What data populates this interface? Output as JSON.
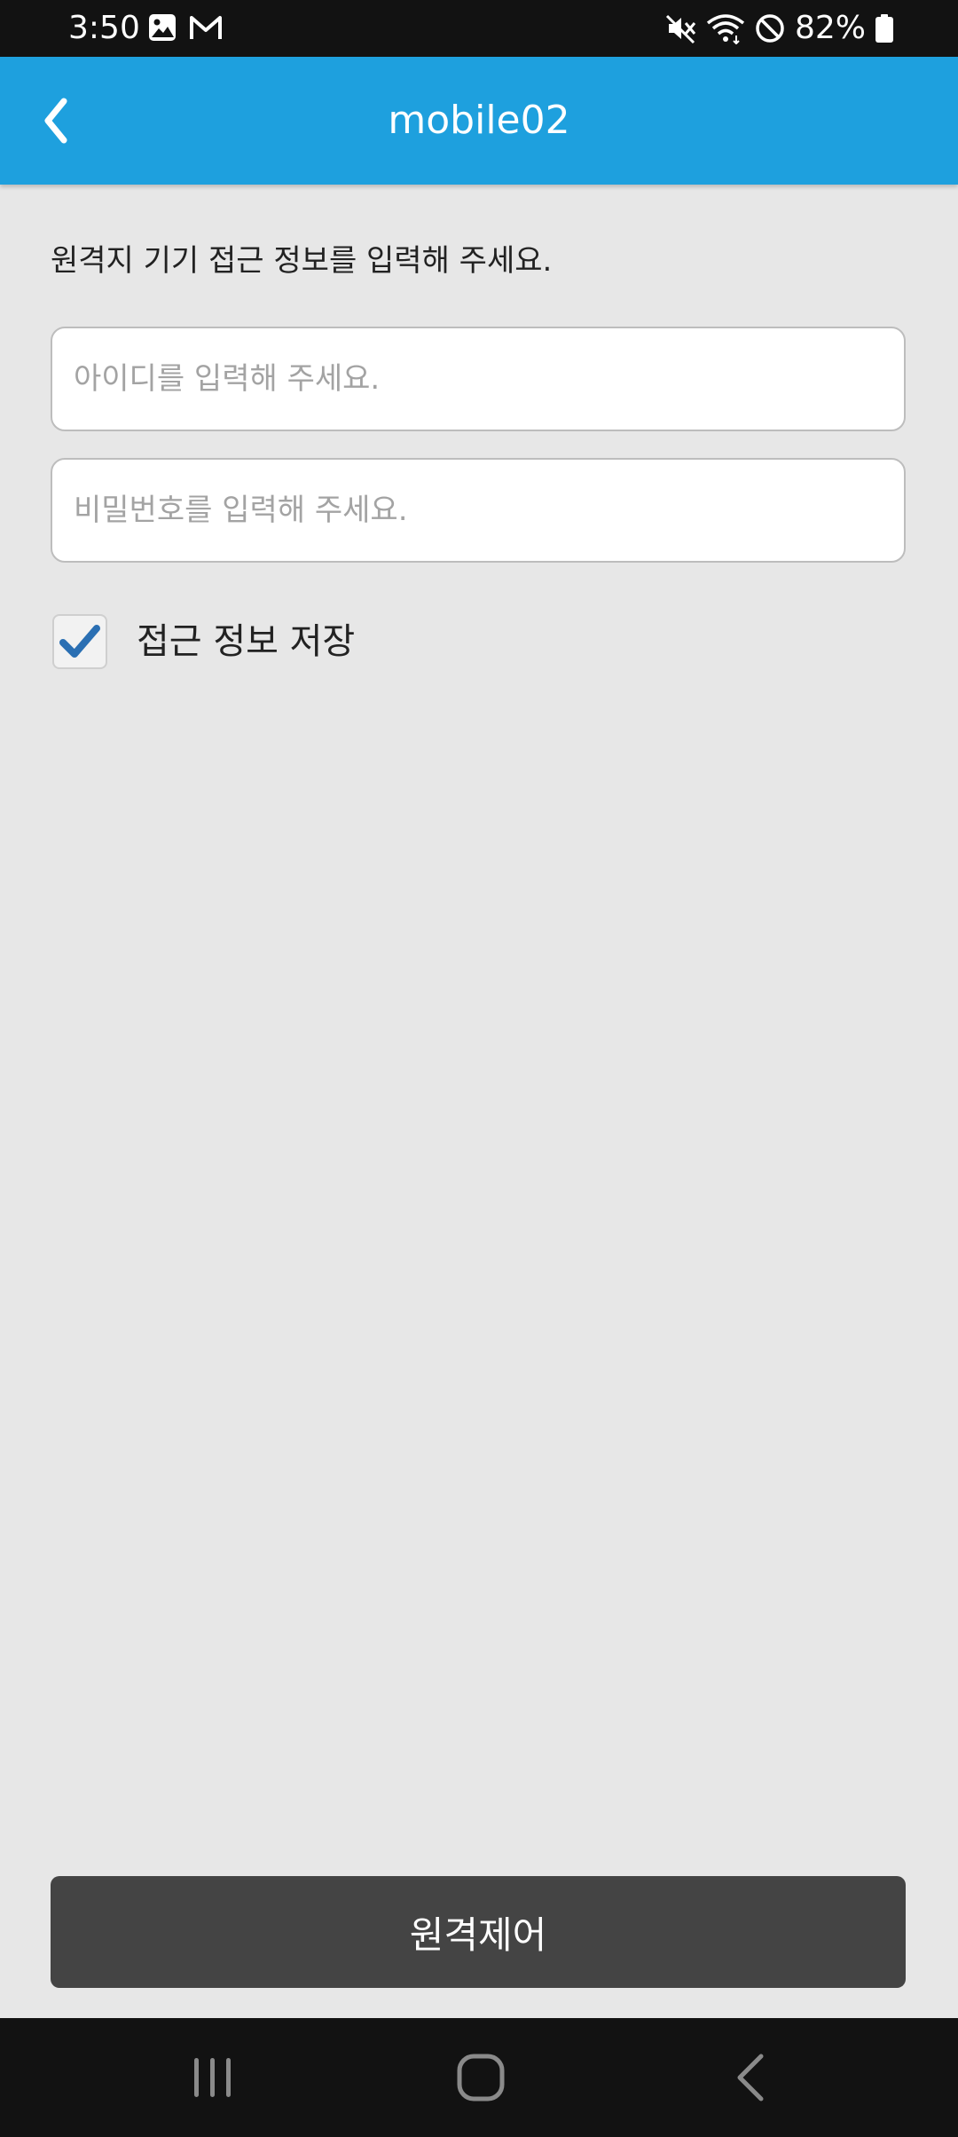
{
  "status_bar": {
    "time": "3:50",
    "battery": "82%",
    "icons_left": [
      "image-icon",
      "gmail-icon"
    ],
    "icons_right": [
      "mute-icon",
      "wifi-icon",
      "do-not-disturb-icon",
      "battery-icon"
    ]
  },
  "app_bar": {
    "title": "mobile02",
    "background_color": "#1ea0de"
  },
  "form": {
    "instruction": "원격지 기기 접근 정보를 입력해 주세요.",
    "id_placeholder": "아이디를 입력해 주세요.",
    "id_value": "",
    "password_placeholder": "비밀번호를 입력해 주세요.",
    "password_value": "",
    "save_checkbox_label": "접근 정보 저장",
    "save_checked": true,
    "check_color": "#2a6fb3"
  },
  "action": {
    "remote_control_label": "원격제어",
    "button_color": "#444444"
  },
  "nav_bar": {
    "buttons": [
      "recent-apps-icon",
      "home-icon",
      "back-icon"
    ]
  }
}
